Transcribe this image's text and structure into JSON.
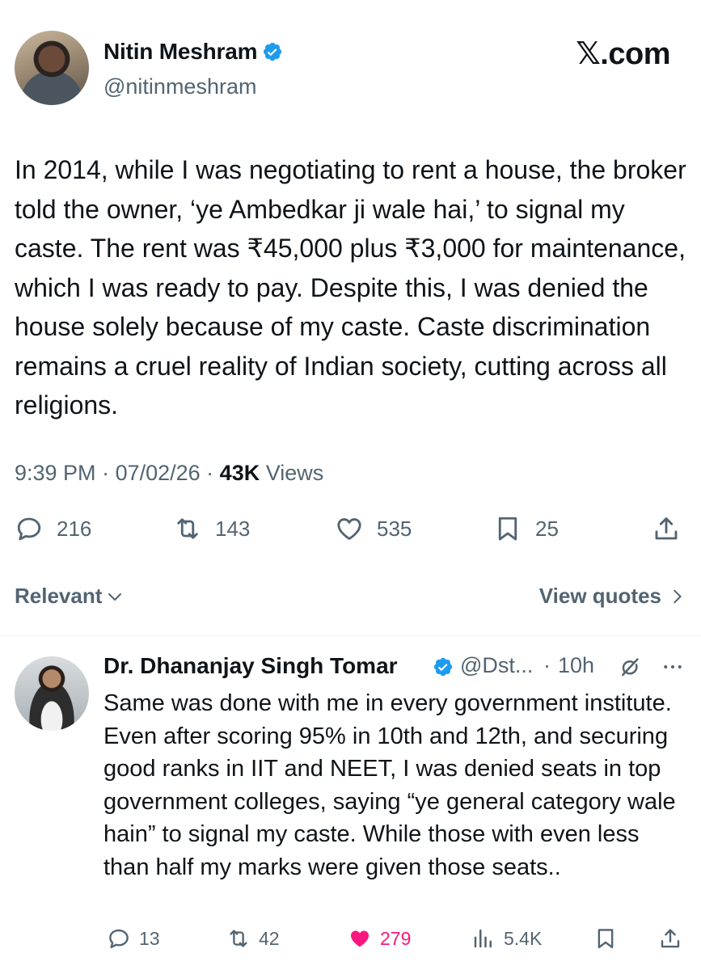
{
  "tweet": {
    "author_name": "Nitin Meshram",
    "author_handle": "@nitinmeshram",
    "brand": "𝕏.com",
    "text": "In 2014, while I was negotiating to rent a house, the broker told the owner, ‘ye Ambedkar ji wale hai,’ to signal my caste. The rent was ₹45,000 plus ₹3,000 for maintenance, which I was ready to pay. Despite this, I was denied the house solely because of my caste. Caste discrimination remains a cruel reality of Indian society, cutting across all religions.",
    "time": "9:39 PM",
    "date": "07/02/26",
    "views_count": "43K",
    "views_label": "Views",
    "replies": "216",
    "reposts": "143",
    "likes": "535",
    "bookmarks": "25"
  },
  "filter": {
    "sort_label": "Relevant",
    "quotes_label": "View quotes"
  },
  "reply": {
    "author_name": "Dr. Dhananjay Singh Tomar",
    "author_handle": "@Dst...",
    "time": "10h",
    "text": "Same was done with me in every government institute. Even after scoring 95% in 10th and 12th, and securing good ranks in IIT and NEET, I was denied seats in top government colleges,  saying “ye general category wale hain” to signal my caste. While those with even less than half my marks were given those seats..",
    "replies": "13",
    "reposts": "42",
    "likes": "279",
    "views": "5.4K"
  },
  "colors": {
    "text": "#0f1419",
    "secondary": "#536471",
    "verified": "#1d9bf0",
    "like": "#f91880"
  },
  "icons": [
    "verified-icon",
    "reply-icon",
    "repost-icon",
    "like-icon",
    "bookmark-icon",
    "share-icon",
    "chevron-down-icon",
    "chevron-right-icon",
    "grok-icon",
    "more-icon",
    "views-icon"
  ]
}
